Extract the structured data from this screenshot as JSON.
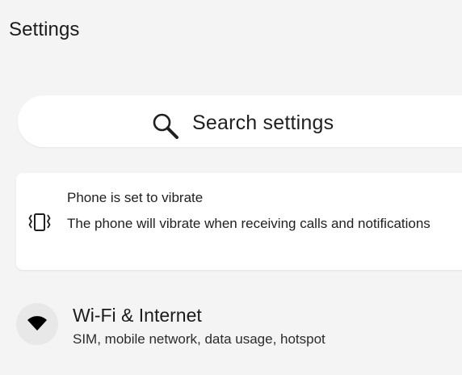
{
  "header": {
    "title": "Settings"
  },
  "search": {
    "label": "Search settings",
    "icon": "search-icon"
  },
  "vibrate_card": {
    "icon": "vibrate-icon",
    "title": "Phone is set to vibrate",
    "description": "The phone will vibrate when receiving calls and notifications"
  },
  "settings_items": [
    {
      "icon": "wifi-icon",
      "title": "Wi-Fi & Internet",
      "subtitle": "SIM, mobile network, data usage, hotspot"
    }
  ],
  "colors": {
    "background": "#f4f4f4",
    "card": "#ffffff",
    "icon_circle": "#e8e8e8",
    "text": "#1b1b1b"
  }
}
